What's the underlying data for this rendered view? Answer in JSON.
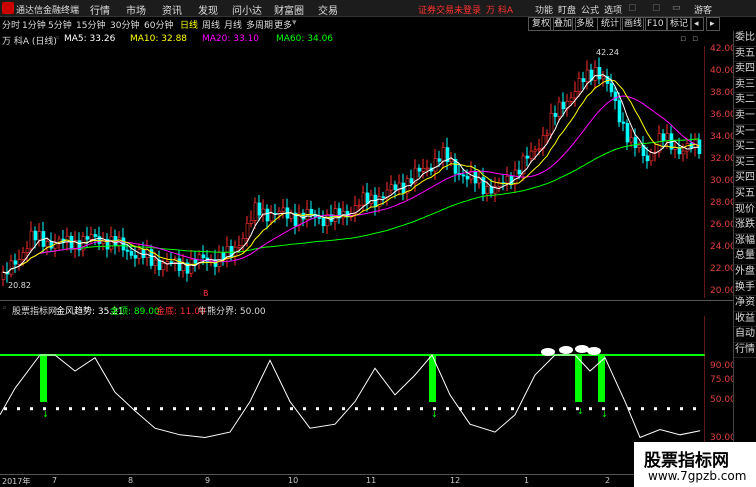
{
  "topbar": {
    "app_title": "通达信金融终端",
    "menu": [
      "行情",
      "市场",
      "资讯",
      "发现",
      "问小达",
      "财富圈",
      "交易"
    ],
    "warning": "证券交易未登录",
    "stock": "万 科A",
    "tools": [
      "功能",
      "盯盘",
      "公式",
      "选项"
    ],
    "user": "游客"
  },
  "toolbar": {
    "periods": [
      "分时",
      "1分钟",
      "5分钟",
      "15分钟",
      "30分钟",
      "60分钟",
      "日线",
      "周线",
      "月线",
      "多周期",
      "更多"
    ],
    "active_period": "日线",
    "right_buttons": [
      "复权",
      "叠加",
      "多股",
      "统计",
      "画线",
      "F10",
      "标记"
    ]
  },
  "info": {
    "name": "万 科A (日线)",
    "ma5": "MA5: 33.26",
    "ma10": "MA10: 32.88",
    "ma20": "MA20: 33.10",
    "ma60": "MA60: 34.06"
  },
  "price_axis": [
    "42.00",
    "40.00",
    "38.00",
    "36.00",
    "34.00",
    "32.00",
    "30.00",
    "28.00",
    "26.00",
    "24.00",
    "22.00",
    "20.00"
  ],
  "annotations": {
    "high": "42.24",
    "low": "20.82"
  },
  "side_panel": [
    "委比",
    "卖五",
    "卖四",
    "卖三",
    "卖二",
    "卖一",
    "买一",
    "买二",
    "买三",
    "买四",
    "买五",
    "现价",
    "涨跌",
    "涨幅",
    "总量",
    "外盘",
    "换手",
    "净资",
    "收益",
    "自动",
    "行情"
  ],
  "indicator": {
    "name": "股票指标网",
    "jf": "金风趋势: 35.21",
    "jd": "金顶: 89.00",
    "jdi": "金底: 11.00",
    "nx": "牛熊分界: 50.00",
    "axis": [
      "90.00",
      "75.00",
      "50.00",
      "30.00"
    ]
  },
  "bottom": {
    "dates": [
      "2017年",
      "7",
      "8",
      "9",
      "10",
      "11",
      "12",
      "1",
      "2"
    ],
    "last": "2018/03/"
  },
  "watermark": {
    "line1": "股票指标网",
    "line2": "www.7gpzb.com"
  },
  "colors": {
    "up": "#ff3030",
    "down": "#00ffff",
    "ma5": "#ffffff",
    "ma10": "#ffff00",
    "ma20": "#ff00ff",
    "ma60": "#00ff00",
    "indicator_bar": "#00ff00"
  }
}
